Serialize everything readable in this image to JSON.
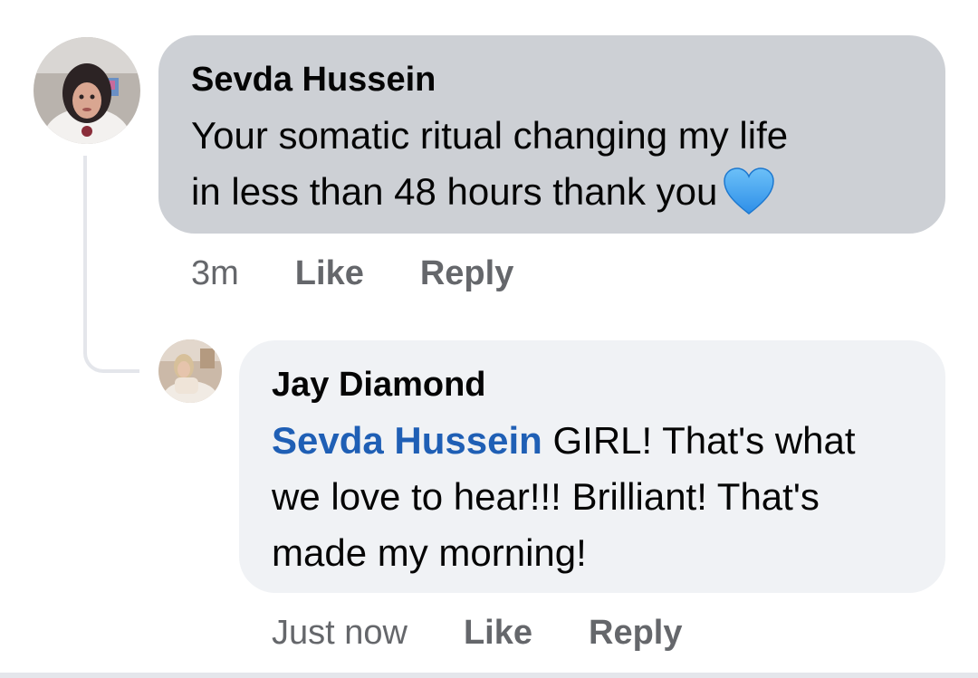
{
  "comment": {
    "author": "Sevda Hussein",
    "text_line1": "Your somatic ritual changing my life",
    "text_line2": "in less than 48 hours thank you",
    "emoji": "blue-heart",
    "time": "3m",
    "like_label": "Like",
    "reply_label": "Reply"
  },
  "reply": {
    "author": "Jay Diamond",
    "mention": "Sevda Hussein",
    "text": " GIRL! That's what we love to hear!!! Brilliant! That's made my morning!",
    "time": "Just now",
    "like_label": "Like",
    "reply_label": "Reply"
  },
  "colors": {
    "comment_bubble": "#cdd0d5",
    "reply_bubble": "#f0f2f5",
    "mention": "#1f5fb5",
    "meta_text": "#65676b",
    "heart": "#3aa0f2"
  }
}
